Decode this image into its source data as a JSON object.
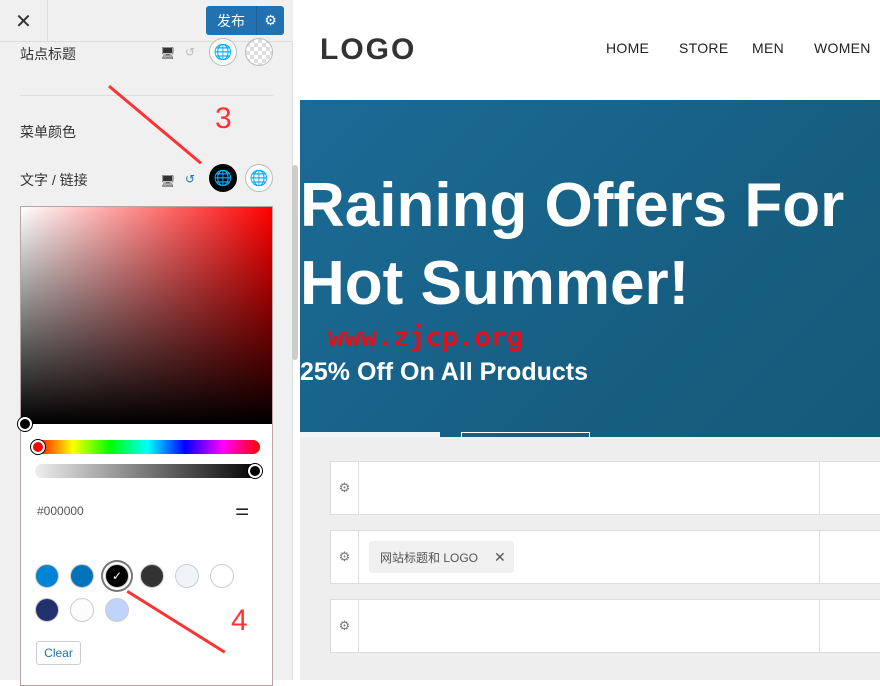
{
  "sidebar": {
    "close_icon": "close-icon",
    "publish_label": "发布",
    "settings_icon": "gear-icon",
    "site_title_label": "站点标题",
    "menu_color_label": "菜单颜色",
    "text_link_label": "文字 / 链接",
    "hex_value": "#000000",
    "clear_label": "Clear",
    "swatches": [
      "#0083d5",
      "#0073bb",
      "#000000",
      "#333333",
      "#f0f4f8",
      "#ffffff",
      "#22316e",
      "#fcfcfc",
      "#c0d3fb"
    ],
    "selected_swatch": "#000000"
  },
  "annotations": {
    "step3": "3",
    "step4": "4",
    "watermark": "www.zjcp.org"
  },
  "preview": {
    "logo": "LOGO",
    "nav": [
      "HOME",
      "STORE",
      "MEN",
      "WOMEN"
    ],
    "hero_title_line1": "Raining Offers For",
    "hero_title_line2": "Hot Summer!",
    "hero_subtitle": "25% Off On All Products"
  },
  "builder": {
    "chip_label": "网站标题和 LOGO"
  },
  "colors": {
    "accent": "#2271b1",
    "hero": "#1a6893",
    "annotation": "#ff3333"
  }
}
